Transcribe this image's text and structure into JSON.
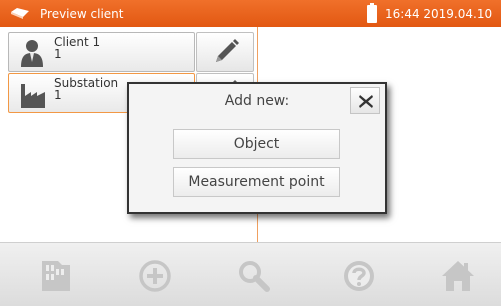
{
  "header": {
    "title": "Preview client",
    "clock": "16:44 2019.04.10",
    "app_icon": "meter-icon",
    "battery_icon": "battery-icon",
    "bg_color": "#e8601c"
  },
  "tree": {
    "items": [
      {
        "label": "Client 1",
        "sub": "1",
        "icon": "person-icon",
        "selected": false
      },
      {
        "label": "Substation",
        "sub": "1",
        "icon": "factory-icon",
        "selected": true
      }
    ],
    "edit_icon": "pencil-icon"
  },
  "dialog": {
    "title": "Add new:",
    "close_icon": "close-icon",
    "options": [
      "Object",
      "Measurement point"
    ]
  },
  "toolbar": {
    "buttons": [
      "memory-card-icon",
      "plus-circle-icon",
      "search-icon",
      "help-icon",
      "home-icon"
    ],
    "icon_color": "#c6c6c6"
  },
  "accent": "#f29845"
}
